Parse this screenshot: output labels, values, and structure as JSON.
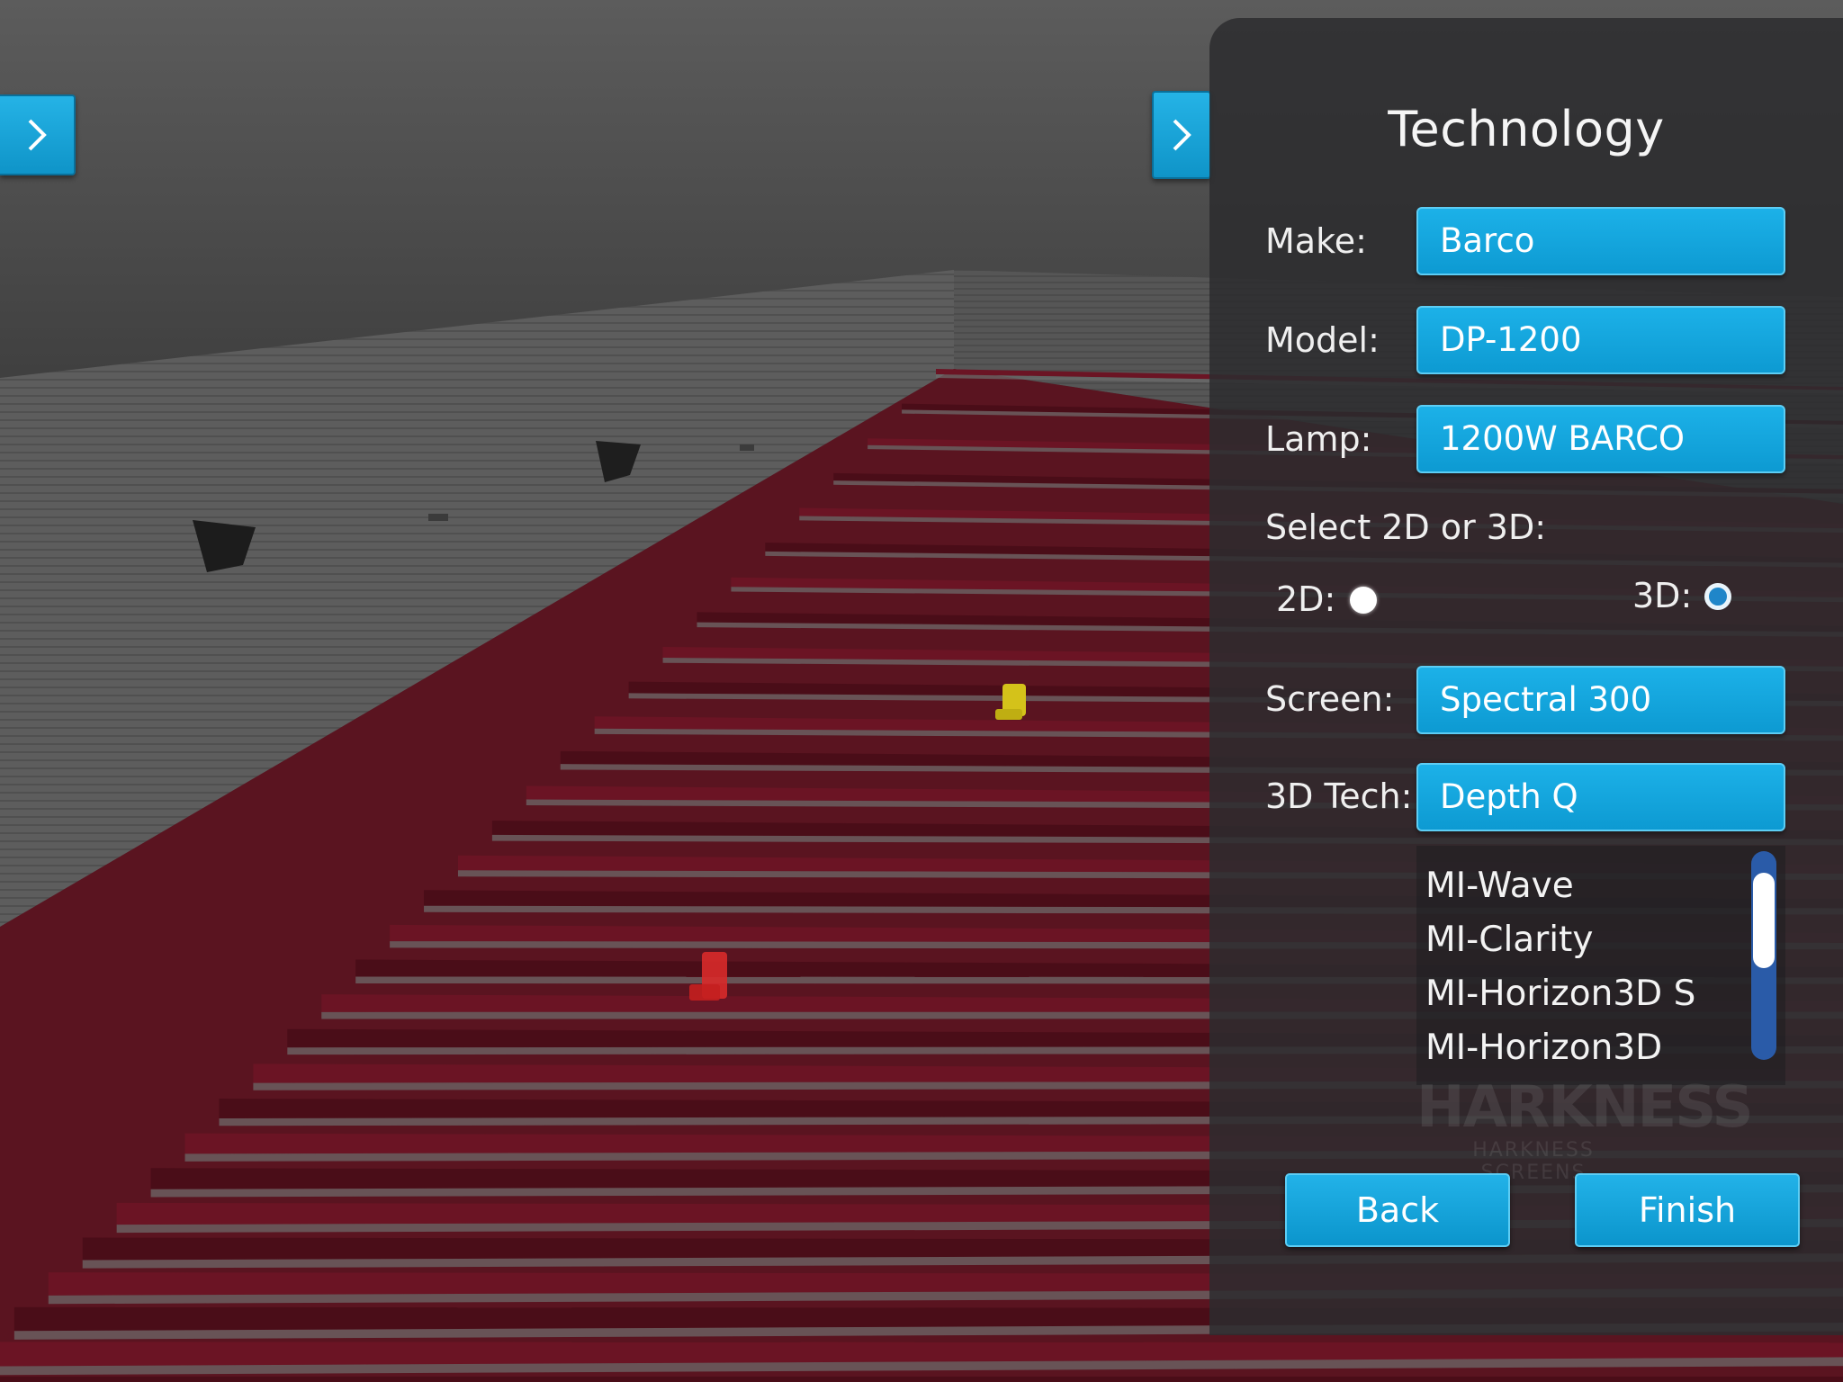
{
  "nav": {
    "left_icon": "chevron-right-icon",
    "right_icon": "chevron-right-icon"
  },
  "panel": {
    "title": "Technology",
    "make_label": "Make:",
    "make_value": "Barco",
    "model_label": "Model:",
    "model_value": "DP-1200",
    "lamp_label": "Lamp:",
    "lamp_value": "1200W BARCO",
    "dimension_prompt": "Select 2D or 3D:",
    "option_2d_label": "2D:",
    "option_3d_label": "3D:",
    "selected_dimension": "3D",
    "screen_label": "Screen:",
    "screen_value": "Spectral 300",
    "tech_label": "3D Tech:",
    "tech_value": "Depth Q",
    "tech_options": [
      "MI-Wave",
      "MI-Clarity",
      "MI-Horizon3D S",
      "MI-Horizon3D"
    ],
    "watermark_logo": "HARKNESS",
    "watermark_text": "HARKNESS SCREENS",
    "back_label": "Back",
    "finish_label": "Finish"
  },
  "colors": {
    "accent": "#13a5dc",
    "panel_bg": "#2c2c2e",
    "seat": "#5e0f1c",
    "seat_highlight_yellow": "#d4c21a",
    "seat_highlight_red": "#d82a2a",
    "scroll_track": "#2a5ba8"
  }
}
